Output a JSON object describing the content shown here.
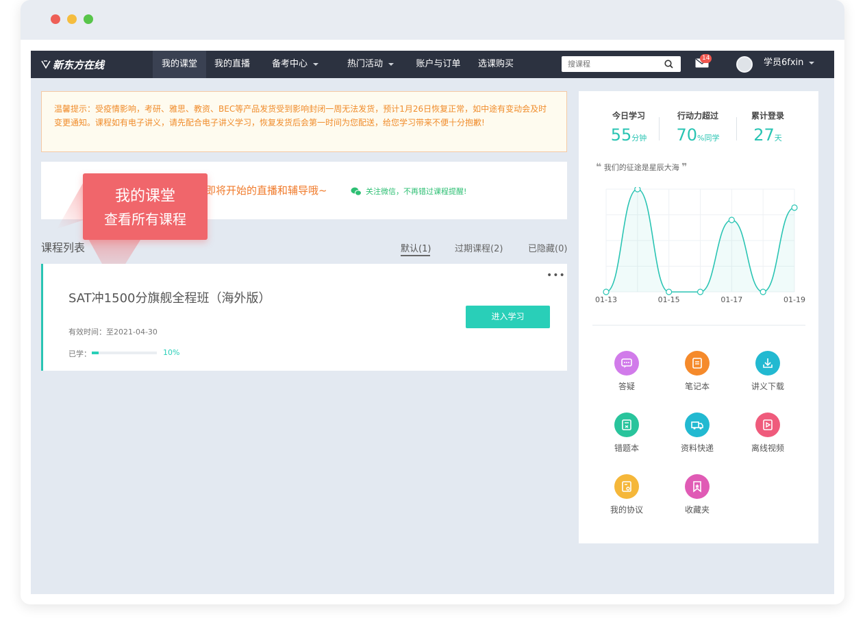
{
  "nav": {
    "logo": "新东方在线",
    "items": [
      {
        "label": "我的课堂",
        "active": true
      },
      {
        "label": "我的直播"
      },
      {
        "label": "备考中心"
      },
      {
        "label": "热门活动"
      },
      {
        "label": "账户与订单"
      },
      {
        "label": "选课购买"
      }
    ],
    "search_placeholder": "搜课程",
    "mail_badge": "14",
    "username": "学员6fxin"
  },
  "notice": "温馨提示：受疫情影响，考研、雅思、教资、BEC等产品发货受到影响封闭一周无法发货，预计1月26日恢复正常，如中途有变动会及时变更通知。课程如有电子讲义，请先配合电子讲义学习，恢复发货后会第一时间为您配送，给您学习带来不便十分抱歉!",
  "live": {
    "text": "即将开始的直播和辅导哦~",
    "wechat": "关注微信，不再错过课程提醒!"
  },
  "tooltip": {
    "title": "我的课堂",
    "subtitle": "查看所有课程"
  },
  "course_list": {
    "title": "课程列表",
    "tabs": [
      "默认(1)",
      "过期课程(2)",
      "已隐藏(0)"
    ],
    "course": {
      "title": "SAT冲1500分旗舰全程班（海外版）",
      "more": "•••",
      "enter_button": "进入学习",
      "valid": "有效时间：至2021-04-30",
      "progress_label": "已学：",
      "progress_pct": "10%",
      "progress_value": 0.1
    }
  },
  "stats": {
    "today": {
      "label": "今日学习",
      "value": "55",
      "unit": "分钟"
    },
    "action": {
      "label": "行动力超过",
      "value": "70",
      "unit": "%同学"
    },
    "login": {
      "label": "累计登录",
      "value": "27",
      "unit": "天"
    }
  },
  "motto": "我们的征途是星辰大海",
  "chart_data": {
    "type": "line",
    "x": [
      "01-13",
      "01-14",
      "01-15",
      "01-16",
      "01-17",
      "01-18",
      "01-19"
    ],
    "x_tick_labels": [
      "01-13",
      "01-15",
      "01-17",
      "01-19"
    ],
    "y": [
      0,
      100,
      0,
      0,
      70,
      0,
      82
    ],
    "ylim": [
      0,
      100
    ],
    "color": "#29c4b3",
    "grid": true
  },
  "tools": [
    {
      "label": "答疑",
      "icon": "qa-icon",
      "color": "#d17bea"
    },
    {
      "label": "笔记本",
      "icon": "notebook-icon",
      "color": "#f58a2b"
    },
    {
      "label": "讲义下载",
      "icon": "download-icon",
      "color": "#22b9d1"
    },
    {
      "label": "错题本",
      "icon": "mistake-book-icon",
      "color": "#29c49c"
    },
    {
      "label": "资料快递",
      "icon": "truck-icon",
      "color": "#22b9d1"
    },
    {
      "label": "离线视频",
      "icon": "video-icon",
      "color": "#ef5b7c"
    },
    {
      "label": "我的协议",
      "icon": "agreement-icon",
      "color": "#f5b73a"
    },
    {
      "label": "收藏夹",
      "icon": "favorites-icon",
      "color": "#e05bb5"
    }
  ]
}
